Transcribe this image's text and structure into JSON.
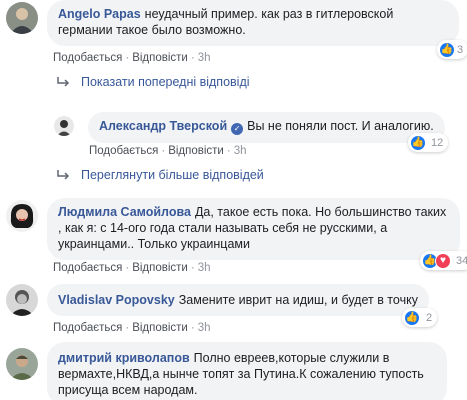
{
  "actions": {
    "like": "Подобається",
    "reply": "Відповісти",
    "dot": "·"
  },
  "comments": [
    {
      "author": "Angelo Papas",
      "text": "неудачный пример. как раз в гитлеровской германии такое было возможно.",
      "time": "3h",
      "reactions": "3"
    },
    {
      "author": "Александр Тверской",
      "verified": true,
      "text": "Вы не поняли пост. И аналогию.",
      "time": "3h",
      "reactions": "12"
    },
    {
      "author": "Людмила Самойлова",
      "text": "Да, такое есть пока. Но большинство таких , как я: с 14-ого года стали называть себя не русскими, а украинцами.. Только украинцами",
      "time": "3h",
      "reactions": "34"
    },
    {
      "author": "Vladislav Popovsky",
      "text": "Замените иврит на идиш, и будет в точку",
      "time": "3h",
      "reactions": "2"
    },
    {
      "author": "дмитрий криволапов",
      "text": "Полно евреев,которые служили в вермахте,НКВД,а нынче топят за Путина.К сожалению тупость присуща всем народам."
    }
  ],
  "replies": {
    "show_previous": "Показати попередні відповіді",
    "view_more": "Переглянути більше відповідей"
  },
  "icons": {
    "reply_arrow": "reply-arrow-icon",
    "like": "like-icon",
    "love": "love-icon"
  }
}
